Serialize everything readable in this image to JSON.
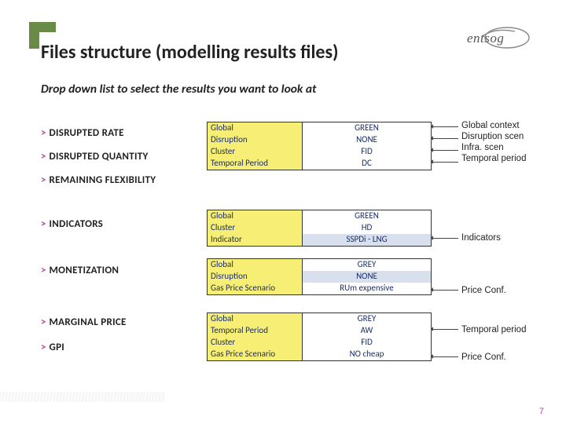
{
  "logo_text": "entsog",
  "title": "Files structure (modelling results files)",
  "subtitle": "Drop down list to select the results you want to look at",
  "nav": {
    "disrupted_rate": "DISRUPTED RATE",
    "disrupted_quantity": "DISRUPTED QUANTITY",
    "remaining_flex": "REMAINING FLEXIBILITY",
    "indicators": "INDICATORS",
    "monetization": "MONETIZATION",
    "marginal_price": "MARGINAL PRICE",
    "gpi": "GPI"
  },
  "tables": {
    "t1": [
      {
        "l": "Global",
        "r": "GREEN"
      },
      {
        "l": "Disruption",
        "r": "NONE"
      },
      {
        "l": "Cluster",
        "r": "FID"
      },
      {
        "l": "Temporal Period",
        "r": "DC"
      }
    ],
    "t2": [
      {
        "l": "Global",
        "r": "GREEN"
      },
      {
        "l": "Cluster",
        "r": "HD"
      },
      {
        "l": "Indicator",
        "r": "SSPDi - LNG",
        "hl": true
      }
    ],
    "t3": [
      {
        "l": "Global",
        "r": "GREY"
      },
      {
        "l": "Disruption",
        "r": "NONE",
        "hl": true
      },
      {
        "l": "Gas Price Scenario",
        "r": "RUm expensive"
      }
    ],
    "t4": [
      {
        "l": "Global",
        "r": "GREY"
      },
      {
        "l": "Temporal Period",
        "r": "AW"
      },
      {
        "l": "Cluster",
        "r": "FID"
      },
      {
        "l": "Gas Price Scenario",
        "r": "NO cheap"
      }
    ]
  },
  "annot": {
    "global_context": "Global context",
    "disruption_scen": "Disruption scen",
    "infra_scen": "Infra. scen",
    "temporal_period": "Temporal period",
    "indicators": "Indicators",
    "price_conf": "Price Conf.",
    "temporal_period2": "Temporal period",
    "price_conf2": "Price Conf."
  },
  "page_number": "7"
}
